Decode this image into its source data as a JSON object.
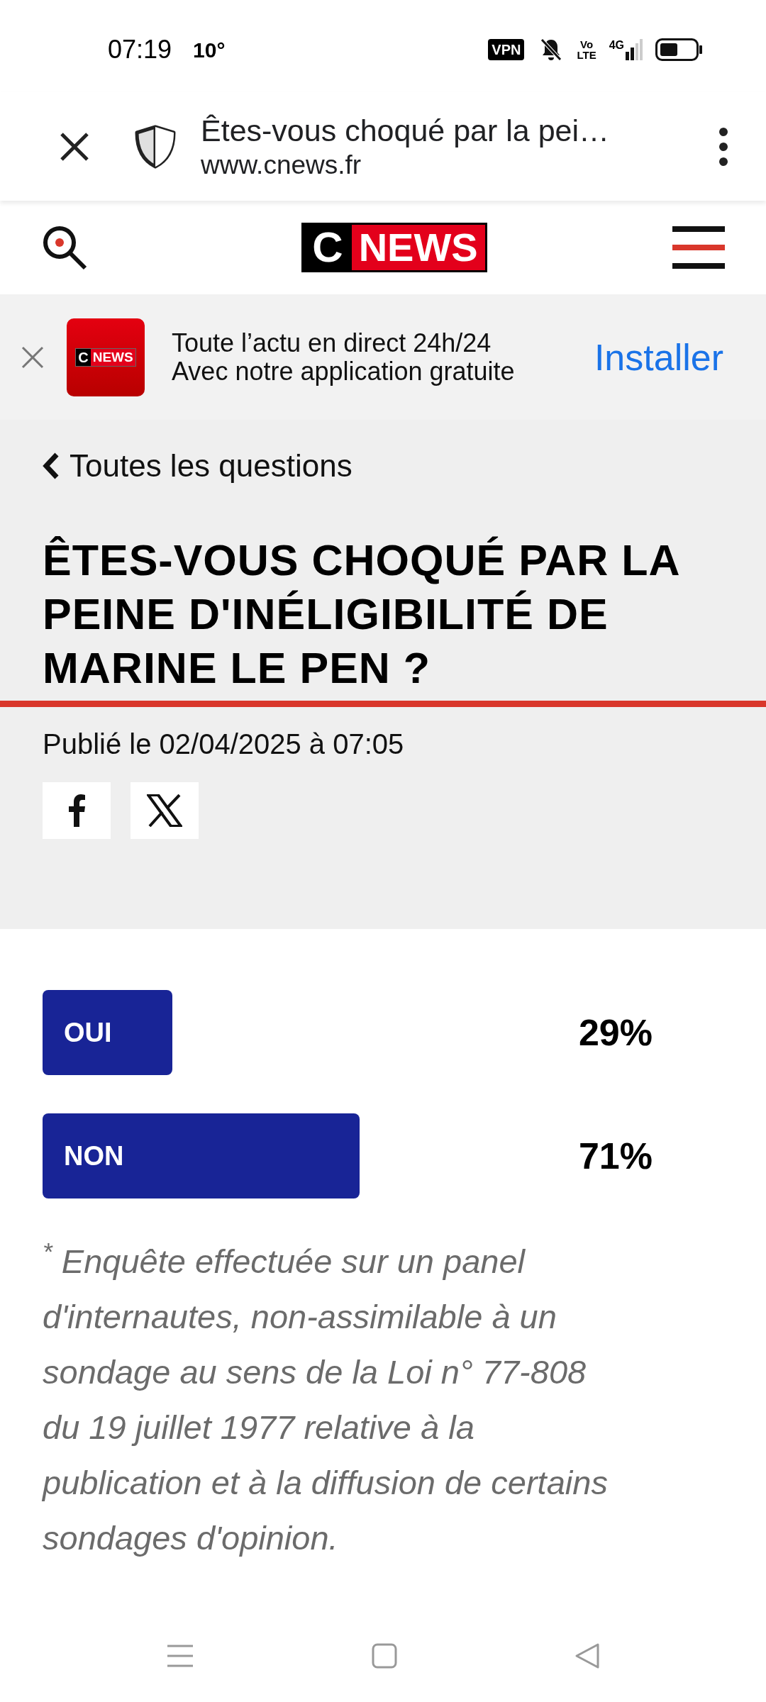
{
  "status_bar": {
    "time": "07:19",
    "temperature": "10°",
    "vpn": "VPN",
    "volte": "Vo\nLTE",
    "network": "4G"
  },
  "browser_bar": {
    "title": "Êtes-vous choqué par la pei…",
    "url": "www.cnews.fr"
  },
  "site_header": {
    "logo_c": "C",
    "logo_news": "NEWS"
  },
  "app_banner": {
    "logo_c": "C",
    "logo_news": "NEWS",
    "line_1": "Toute l’actu en direct 24h/24",
    "line_2": "Avec notre application gratuite",
    "action": "Installer"
  },
  "article": {
    "back_link": "Toutes les questions",
    "title": "ÊTES-VOUS CHOQUÉ PAR LA PEINE D'INÉLIGIBILITÉ DE MARINE LE PEN ?",
    "published": "Publié le 02/04/2025 à 07:05"
  },
  "poll": {
    "answers": [
      {
        "label": "OUI",
        "percent": "29%"
      },
      {
        "label": "NON",
        "percent": "71%"
      }
    ],
    "footnote": "$^{*}$ Enquête effectuée sur un panel d'internautes, non-assimilable à un sondage au sens de la Loi n° 77-808 du 19 juillet 1977 relative à la publication et à la diffusion de certains sondages d'opinion."
  }
}
